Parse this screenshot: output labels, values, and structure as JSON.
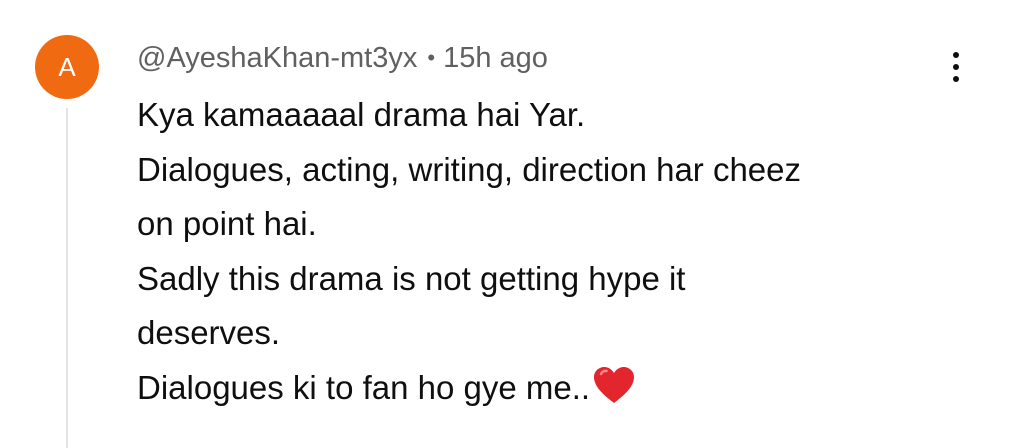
{
  "comment": {
    "avatar_letter": "A",
    "avatar_color": "#f06a12",
    "author": "@AyeshaKhan-mt3yx",
    "separator": "•",
    "time_ago": "15h ago",
    "lines": [
      "Kya kamaaaaal drama hai Yar.",
      "Dialogues, acting, writing, direction har cheez",
      "on point hai.",
      "Sadly this drama is not getting hype it",
      "deserves.",
      "Dialogues ki to fan ho gye me.."
    ],
    "emoji": "red-heart-emoji",
    "menu_icon": "more-vert-icon"
  }
}
